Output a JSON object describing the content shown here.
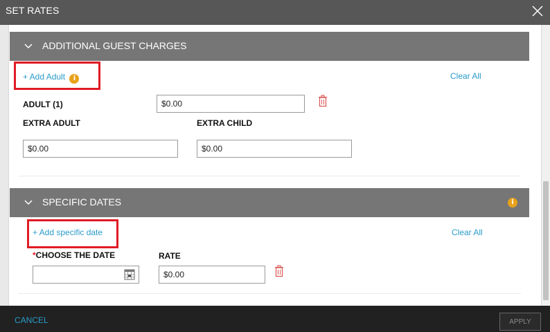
{
  "window": {
    "title": "SET RATES"
  },
  "additional_guest_charges": {
    "header": "ADDITIONAL GUEST CHARGES",
    "add_link": "+ Add Adult",
    "clear_all": "Clear All",
    "adult_label": "ADULT (1)",
    "adult_value": "$0.00",
    "extra_adult_label": "EXTRA ADULT",
    "extra_adult_value": "$0.00",
    "extra_child_label": "EXTRA CHILD",
    "extra_child_value": "$0.00"
  },
  "specific_dates": {
    "header": "SPECIFIC DATES",
    "add_link": "+ Add specific date",
    "clear_all": "Clear All",
    "required_mark": "*",
    "date_label": "CHOOSE THE DATE",
    "date_value": "",
    "rate_label": "RATE",
    "rate_value": "$0.00"
  },
  "footer": {
    "cancel_label": "CANCEL",
    "apply_label": "APPLY"
  },
  "icons": {
    "info": "i",
    "info_color": "#e8a21a",
    "trash_color": "#d9534f",
    "highlight_color": "#e01b24",
    "link_color": "#2a9bc9"
  }
}
